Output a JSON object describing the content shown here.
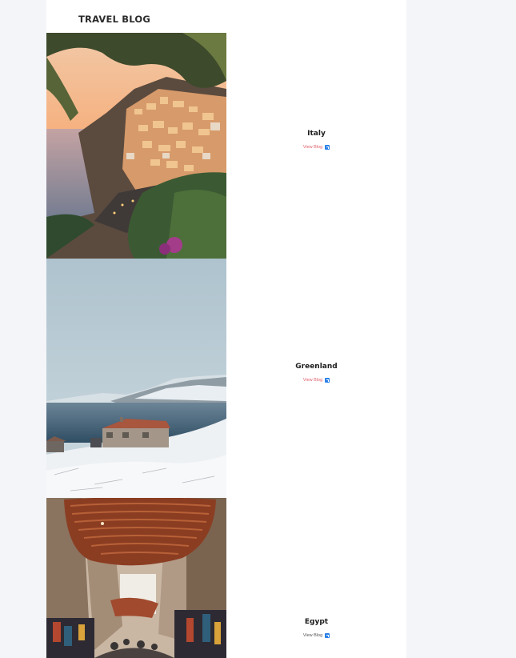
{
  "blog": {
    "title": "TRAVEL BLOG"
  },
  "cards": [
    {
      "name": "Italy",
      "link_label": "View Blog",
      "link_color": "#e0606e",
      "link_icon": "external-link-icon"
    },
    {
      "name": "Greenland",
      "link_label": "View Blog",
      "link_color": "#e0606e",
      "link_icon": "external-link-icon"
    },
    {
      "name": "Egypt",
      "link_label": "View Blog",
      "link_color": "#555555",
      "link_icon": "external-link-icon"
    }
  ]
}
